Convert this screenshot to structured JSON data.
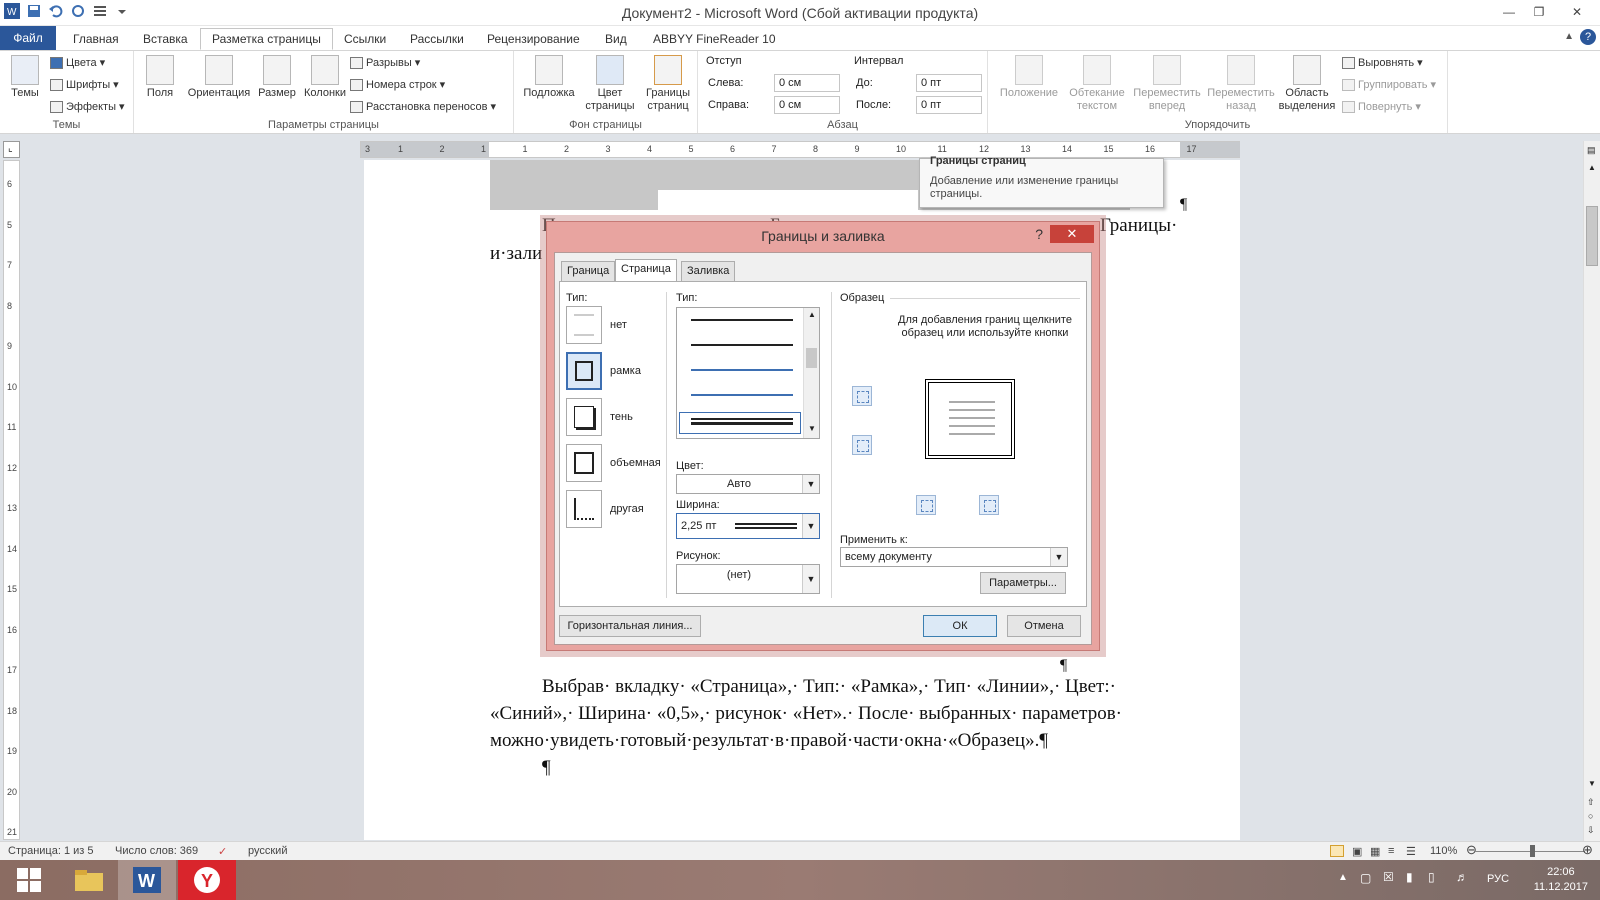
{
  "window": {
    "title": "Документ2 - Microsoft Word (Сбой активации продукта)"
  },
  "ribbon_tabs": [
    "Файл",
    "Главная",
    "Вставка",
    "Разметка страницы",
    "Ссылки",
    "Рассылки",
    "Рецензирование",
    "Вид",
    "ABBYY FineReader 10"
  ],
  "ribbon": {
    "themes": {
      "big": "Темы",
      "colors": "Цвета",
      "fonts": "Шрифты",
      "effects": "Эффекты",
      "group": "Темы"
    },
    "page_setup": {
      "margins": "Поля",
      "orientation": "Ориентация",
      "size": "Размер",
      "columns": "Колонки",
      "breaks": "Разрывы",
      "line_numbers": "Номера строк",
      "hyphenation": "Расстановка переносов",
      "group": "Параметры страницы"
    },
    "background": {
      "watermark": "Подложка",
      "color_l1": "Цвет",
      "color_l2": "страницы",
      "borders_l1": "Границы",
      "borders_l2": "страниц",
      "group": "Фон страницы"
    },
    "paragraph": {
      "indent": "Отступ",
      "left_label": "Слева:",
      "left_val": "0 см",
      "right_label": "Справа:",
      "right_val": "0 см",
      "spacing": "Интервал",
      "before_label": "До:",
      "before_val": "0 пт",
      "after_label": "После:",
      "after_val": "0 пт",
      "group": "Абзац"
    },
    "arrange": {
      "position": "Положение",
      "wrap_l1": "Обтекание",
      "wrap_l2": "текстом",
      "fwd_l1": "Переместить",
      "fwd_l2": "вперед",
      "back_l1": "Переместить",
      "back_l2": "назад",
      "sel_l1": "Область",
      "sel_l2": "выделения",
      "align": "Выровнять",
      "group_btn": "Группировать",
      "rotate": "Повернуть",
      "group": "Упорядочить"
    }
  },
  "ruler_numbers": [
    "3",
    "1",
    "2",
    "1",
    "1",
    "2",
    "3",
    "4",
    "5",
    "6",
    "7",
    "8",
    "9",
    "10",
    "11",
    "12",
    "13",
    "14",
    "15",
    "16",
    "17"
  ],
  "ruler_v_numbers": [
    "6",
    "5",
    "7",
    "8",
    "9",
    "10",
    "11",
    "12",
    "13",
    "14",
    "15",
    "16",
    "17",
    "18",
    "19",
    "20",
    "21"
  ],
  "tooltip": {
    "title": "Границы страниц",
    "text": "Добавление или изменение границы страницы."
  },
  "document": {
    "frag_left": "П",
    "frag_mid": "Б",
    "frag_right": "Границы·",
    "line2": "и·зали",
    "pilcrow": "¶",
    "para_line1": "Выбрав· вкладку· «Страница»,· Тип:· «Рамка»,· Тип· «Линии»,· Цвет:·",
    "para_line2": "«Синий»,· Ширина· «0,5»,· рисунок· «Нет».· После· выбранных· параметров·",
    "para_line3": "можно·увидеть·готовый·результат·в·правой·части·окна·«Образец».¶"
  },
  "dialog": {
    "title": "Границы и заливка",
    "help": "?",
    "close": "✕",
    "tabs": [
      "Граница",
      "Страница",
      "Заливка"
    ],
    "setting_label": "Тип:",
    "settings": [
      "нет",
      "рамка",
      "тень",
      "объемная",
      "другая"
    ],
    "style_label": "Тип:",
    "color_label": "Цвет:",
    "color_value": "Авто",
    "width_label": "Ширина:",
    "width_value": "2,25 пт",
    "art_label": "Рисунок:",
    "art_value": "(нет)",
    "preview_label": "Образец",
    "preview_hint": "Для добавления границ щелкните образец или используйте кнопки",
    "apply_label": "Применить к:",
    "apply_value": "всему документу",
    "options_btn": "Параметры...",
    "hline_btn": "Горизонтальная линия...",
    "ok": "ОК",
    "cancel": "Отмена"
  },
  "status": {
    "page": "Страница: 1 из 5",
    "words": "Число слов: 369",
    "lang": "русский",
    "zoom": "110%"
  },
  "taskbar": {
    "lang": "РУС",
    "time": "22:06",
    "date": "11.12.2017"
  },
  "colors": {
    "accent": "#2b579a",
    "dialog_frame": "#e8a4a0",
    "close": "#c7423a",
    "selection": "#3d6fb2"
  }
}
